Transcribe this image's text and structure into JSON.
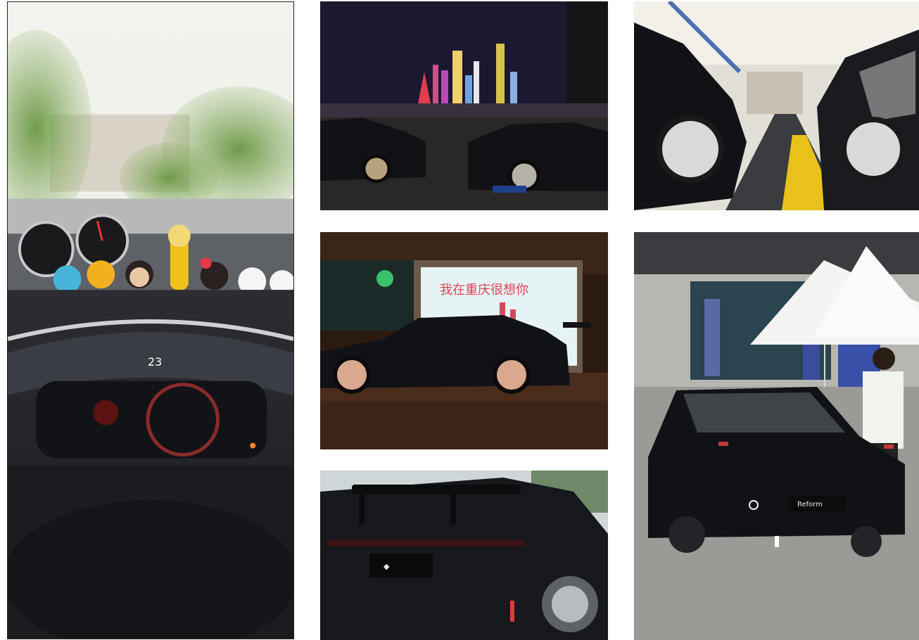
{
  "photos": [
    {
      "id": "dashboard",
      "subject": "car interior dashboard with toy figurines"
    },
    {
      "id": "night-city",
      "subject": "black cars parked at night with city skyline"
    },
    {
      "id": "billboard",
      "subject": "lowered black sedan in front of a lit billboard at night"
    },
    {
      "id": "rear-wing",
      "subject": "rear view of black car with spoiler wing"
    },
    {
      "id": "garage",
      "subject": "two modified cars in an indoor show hall"
    },
    {
      "id": "car-show",
      "subject": "black car at outdoor car show with white tents"
    }
  ],
  "texts": {
    "speed_readout": "23",
    "billboard_text": "我在重庆很想你",
    "plate_text": "Reform"
  },
  "colors": {
    "car_black": "#111216",
    "night_sky": "#1b1830",
    "sky_day": "#f1f1ec"
  }
}
